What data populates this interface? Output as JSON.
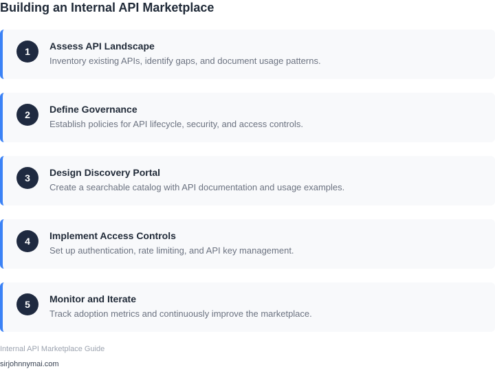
{
  "title": "Building an Internal API Marketplace",
  "steps": [
    {
      "number": "1",
      "title": "Assess API Landscape",
      "description": "Inventory existing APIs, identify gaps, and document usage patterns."
    },
    {
      "number": "2",
      "title": "Define Governance",
      "description": "Establish policies for API lifecycle, security, and access controls."
    },
    {
      "number": "3",
      "title": "Design Discovery Portal",
      "description": "Create a searchable catalog with API documentation and usage examples."
    },
    {
      "number": "4",
      "title": "Implement Access Controls",
      "description": "Set up authentication, rate limiting, and API key management."
    },
    {
      "number": "5",
      "title": "Monitor and Iterate",
      "description": "Track adoption metrics and continuously improve the marketplace."
    }
  ],
  "footer": {
    "note": "Internal API Marketplace Guide",
    "site": "sirjohnnymai.com"
  },
  "colors": {
    "accent": "#3b82f6",
    "badge": "#1f2a40",
    "card_background": "#f8f9fb"
  }
}
